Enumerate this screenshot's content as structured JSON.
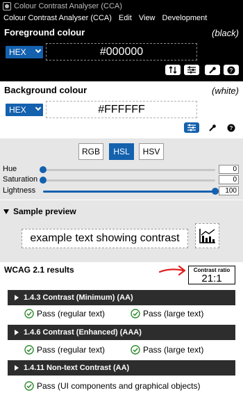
{
  "window": {
    "title": "Colour Contrast Analyser (CCA)"
  },
  "menu": {
    "items": [
      "Colour Contrast Analyser (CCA)",
      "Edit",
      "View",
      "Development"
    ]
  },
  "foreground": {
    "title": "Foreground colour",
    "name": "(black)",
    "format": "HEX",
    "value": "#000000"
  },
  "background": {
    "title": "Background colour",
    "name": "(white)",
    "format": "HEX",
    "value": "#FFFFFF"
  },
  "color_model": {
    "tabs": [
      "RGB",
      "HSL",
      "HSV"
    ],
    "active": "HSL",
    "sliders": [
      {
        "label": "Hue",
        "value": "0",
        "fraction": 0
      },
      {
        "label": "Saturation",
        "value": "0",
        "fraction": 0
      },
      {
        "label": "Lightness",
        "value": "100",
        "fraction": 1
      }
    ]
  },
  "sample": {
    "title": "Sample preview",
    "text": "example text showing contrast"
  },
  "results": {
    "title": "WCAG 2.1 results",
    "ratio_label": "Contrast ratio",
    "ratio_value": "21:1",
    "criteria": [
      {
        "label": "1.4.3 Contrast (Minimum) (AA)",
        "passes": [
          "Pass (regular text)",
          "Pass (large text)"
        ]
      },
      {
        "label": "1.4.6 Contrast (Enhanced) (AAA)",
        "passes": [
          "Pass (regular text)",
          "Pass (large text)"
        ]
      },
      {
        "label": "1.4.11 Non-text Contrast (AA)",
        "passes": [
          "Pass (UI components and graphical objects)"
        ]
      }
    ]
  },
  "colors": {
    "accent": "#1461ae",
    "pass": "#2e8b2e",
    "annotation": "#e02020"
  }
}
